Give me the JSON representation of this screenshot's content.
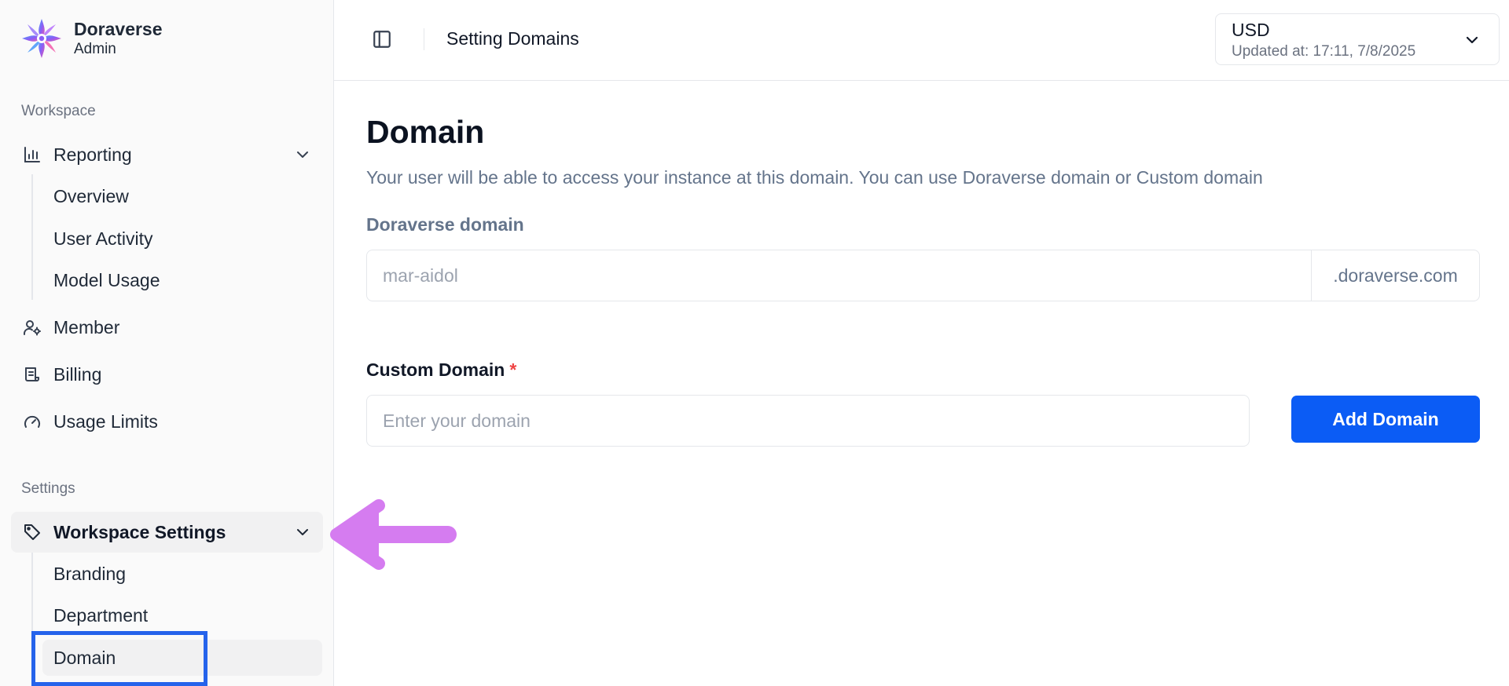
{
  "brand": {
    "name": "Doraverse",
    "role": "Admin",
    "logo_colors": [
      "#6d5cf6",
      "#c35cf6",
      "#f05ca8",
      "#4fa3f7"
    ]
  },
  "sidebar": {
    "workspace_label": "Workspace",
    "reporting": {
      "label": "Reporting",
      "icon": "bar-chart-icon",
      "expanded": true,
      "children": [
        "Overview",
        "User Activity",
        "Model Usage"
      ]
    },
    "member": {
      "label": "Member",
      "icon": "user-gear-icon"
    },
    "billing": {
      "label": "Billing",
      "icon": "receipt-icon"
    },
    "usage_limits": {
      "label": "Usage Limits",
      "icon": "gauge-icon"
    },
    "settings_label": "Settings",
    "workspace_settings": {
      "label": "Workspace Settings",
      "icon": "tag-icon",
      "expanded": true,
      "active": true,
      "children": [
        "Branding",
        "Department",
        "Domain"
      ],
      "active_child": "Domain"
    }
  },
  "header": {
    "title": "Setting Domains",
    "toggle_icon": "sidebar-toggle-icon",
    "currency": {
      "code": "USD",
      "updated": "Updated at: 17:11, 7/8/2025"
    }
  },
  "main": {
    "title": "Domain",
    "description": "Your user will be able to access your instance at this domain. You can use Doraverse domain or Custom domain",
    "doraverse_domain": {
      "label": "Doraverse domain",
      "value": "mar-aidol",
      "suffix": ".doraverse.com"
    },
    "custom_domain": {
      "label": "Custom Domain",
      "required_mark": "*",
      "placeholder": "Enter your domain",
      "value": ""
    },
    "add_button": "Add Domain"
  },
  "colors": {
    "accent": "#0b5cf5",
    "highlight_box": "#2563eb",
    "annotation_arrow": "#d57cf0",
    "required": "#ef4444"
  }
}
